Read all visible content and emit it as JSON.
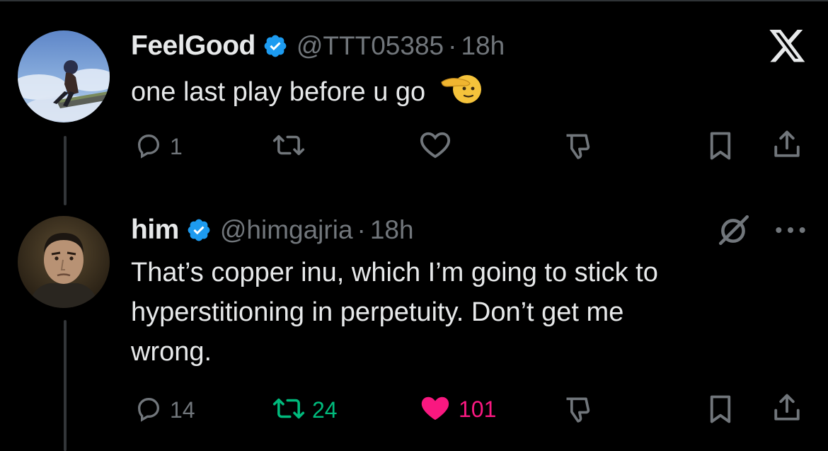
{
  "tweets": [
    {
      "author_name": "FeelGood",
      "handle": "@TTT05385",
      "separator": "·",
      "time": "18h",
      "text": "one last play before u go",
      "emoji": "🫡",
      "reply_count": "1",
      "retweet_count": "",
      "like_count": ""
    },
    {
      "author_name": "him",
      "handle": "@himgajria",
      "separator": "·",
      "time": "18h",
      "text_lines": [
        "That’s copper inu, which I’m going to stick to",
        "hyperstitioning in perpetuity. Don’t get me",
        "wrong."
      ],
      "reply_count": "14",
      "retweet_count": "24",
      "like_count": "101"
    }
  ],
  "colors": {
    "background": "#000000",
    "text": "#e7e9ea",
    "muted": "#71767b",
    "verified": "#1d9bf0",
    "retweet_active": "#00ba7c",
    "like_active": "#f91880"
  },
  "icons": {
    "brand": "x-logo-icon",
    "reply": "reply-icon",
    "retweet": "retweet-icon",
    "like": "heart-icon",
    "dislike": "thumbs-down-icon",
    "bookmark": "bookmark-icon",
    "share": "share-icon",
    "grok": "grok-icon",
    "more": "more-dots-icon"
  }
}
